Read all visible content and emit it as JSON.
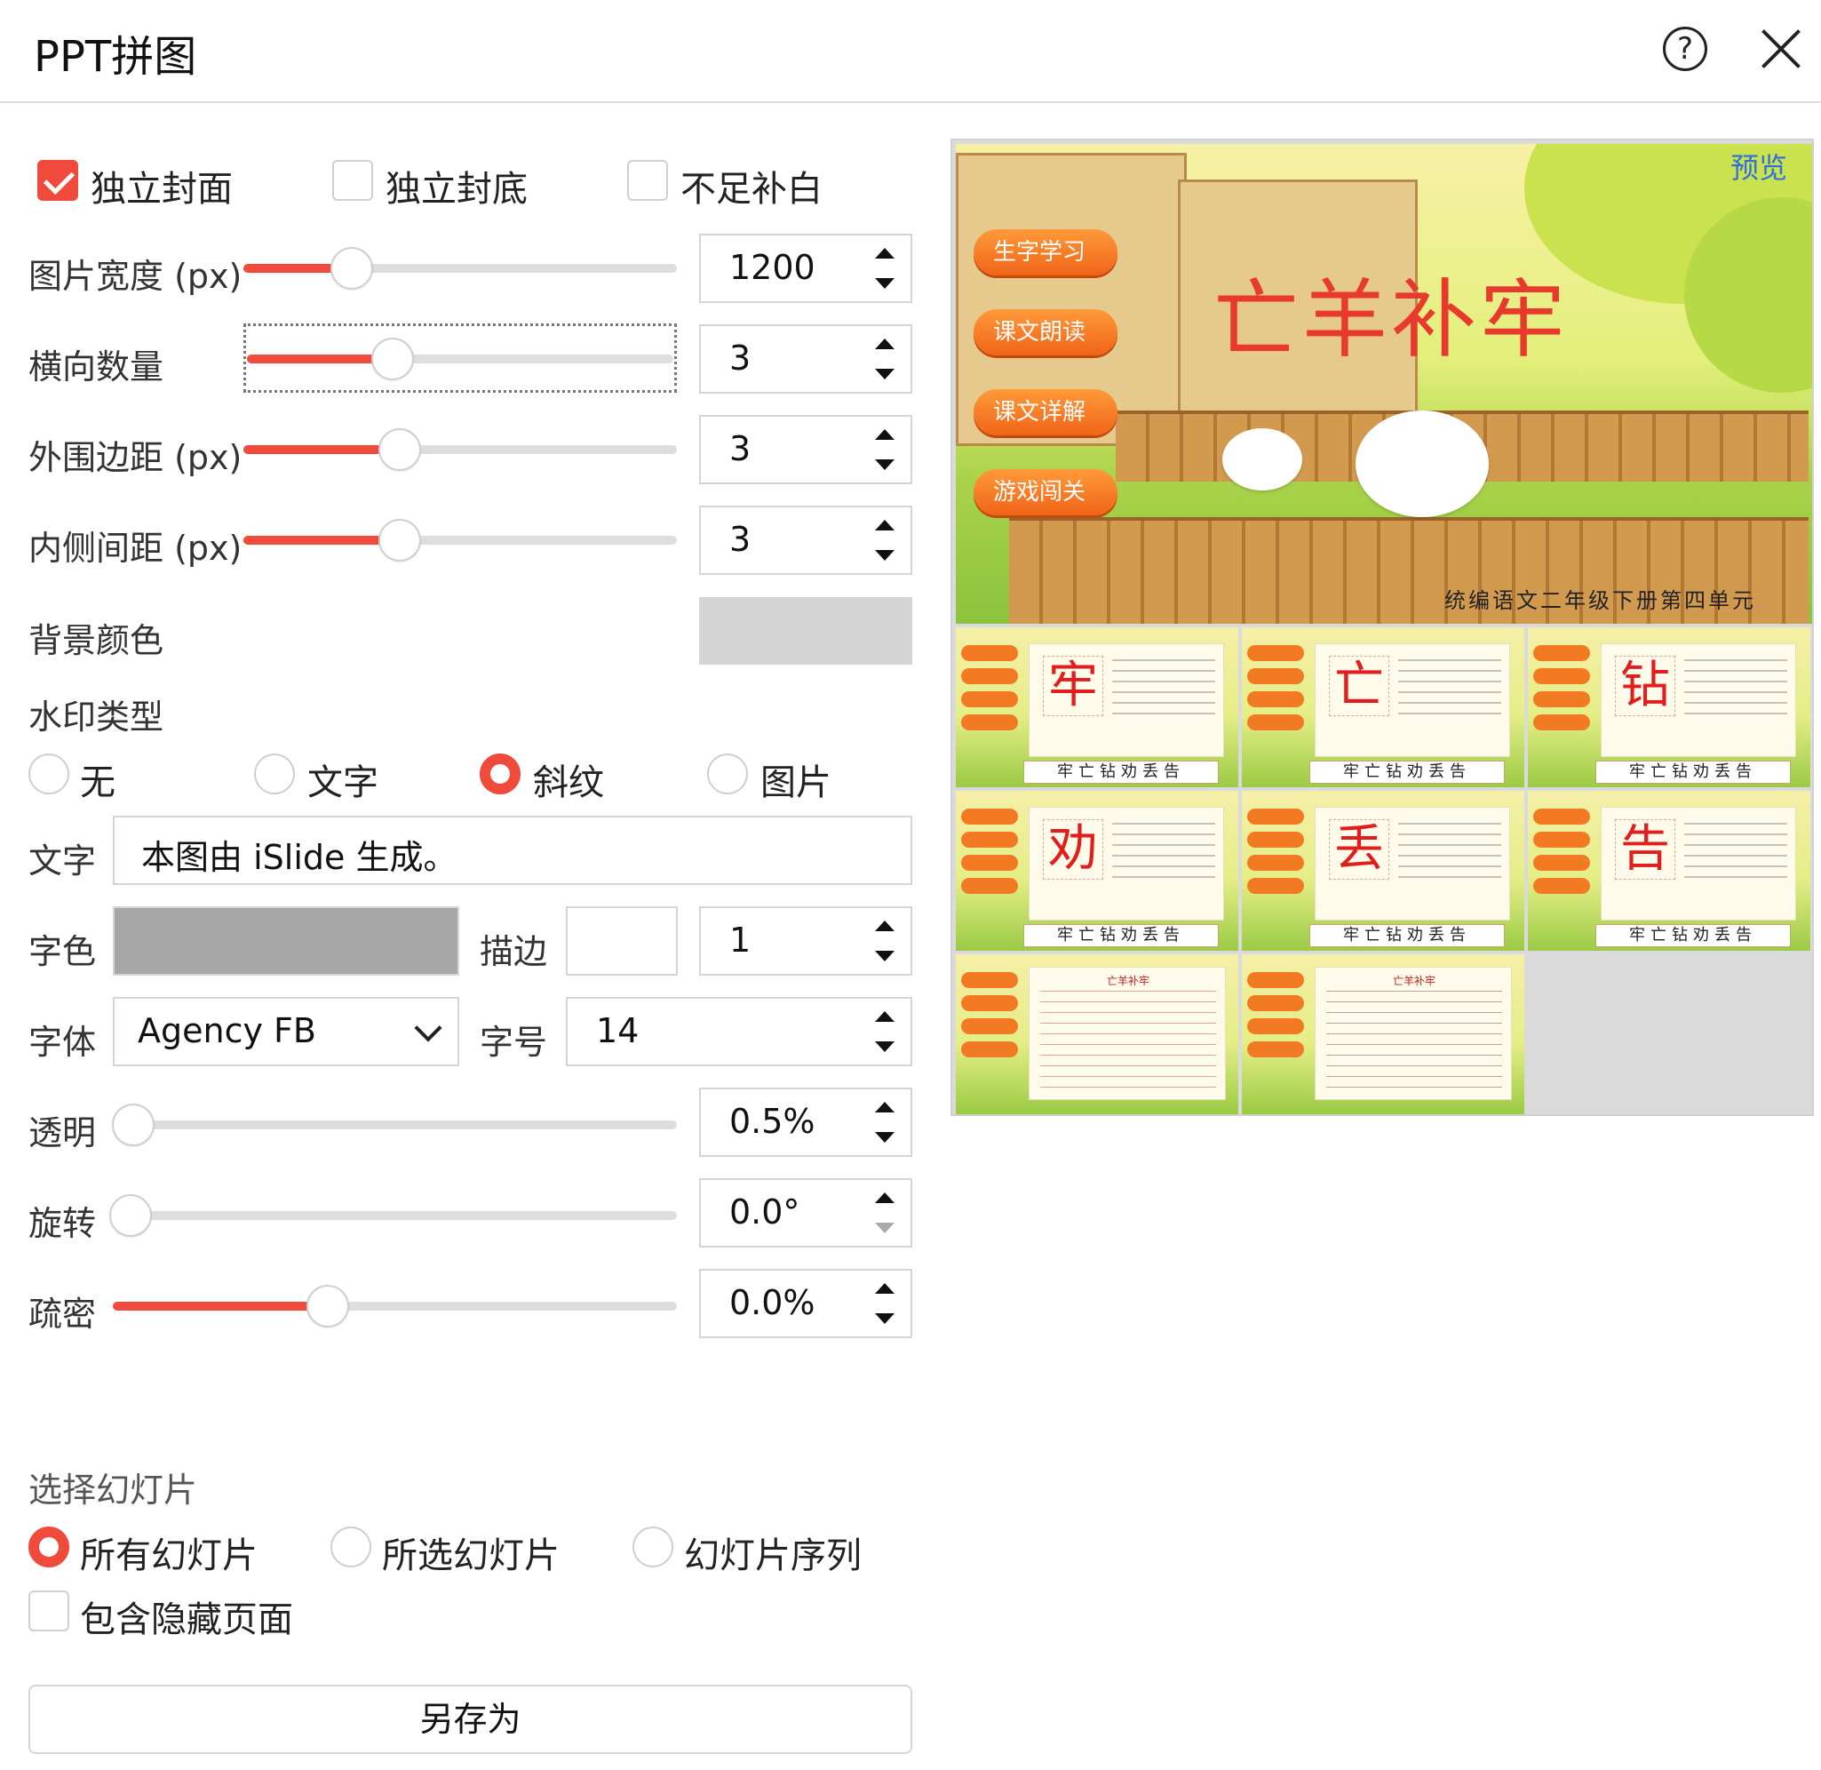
{
  "title": "PPT拼图",
  "checkboxes": {
    "cover": "独立封面",
    "back": "独立封底",
    "fill": "不足补白"
  },
  "labels": {
    "width": "图片宽度 (px)",
    "count": "横向数量",
    "outer": "外围边距 (px)",
    "inner": "内侧间距 (px)",
    "bg": "背景颜色",
    "watermark_type": "水印类型",
    "text": "文字",
    "font_color": "字色",
    "stroke": "描边",
    "font": "字体",
    "font_size": "字号",
    "opacity": "透明",
    "rotate": "旋转",
    "density": "疏密"
  },
  "values": {
    "width": "1200",
    "count": "3",
    "outer": "3",
    "inner": "3",
    "stroke": "1",
    "font_size": "14",
    "opacity": "0.5%",
    "rotate": "0.0°",
    "density": "0.0%",
    "text": "本图由 iSlide 生成。",
    "font": "Agency FB"
  },
  "slider_levels": {
    "width": 0.21,
    "count": 0.3,
    "outer": 0.32,
    "inner": 0.32,
    "opacity": 0.005,
    "rotate": 0.0,
    "density": 0.35
  },
  "watermark_options": [
    "无",
    "文字",
    "斜纹",
    "图片"
  ],
  "select_slides": {
    "title": "选择幻灯片",
    "options": [
      "所有幻灯片",
      "所选幻灯片",
      "幻灯片序列"
    ],
    "hidden": "包含隐藏页面"
  },
  "save_label": "另存为",
  "colors": {
    "accent": "#f04a3c",
    "bg_color": "#d4d4d4",
    "font_color": "#a6a6a6"
  },
  "preview": {
    "tag": "预览",
    "cover_title": "亡羊补牢",
    "cover_subtitle": "统编语文二年级下册第四单元",
    "cover_menu": [
      "生字学习",
      "课文朗读",
      "课文详解",
      "游戏闯关"
    ],
    "char_strip": "牢亡钻劝丢告",
    "chars": [
      "牢",
      "亡",
      "钻",
      "劝",
      "丢",
      "告"
    ],
    "text_page_title": "亡羊补牢"
  }
}
